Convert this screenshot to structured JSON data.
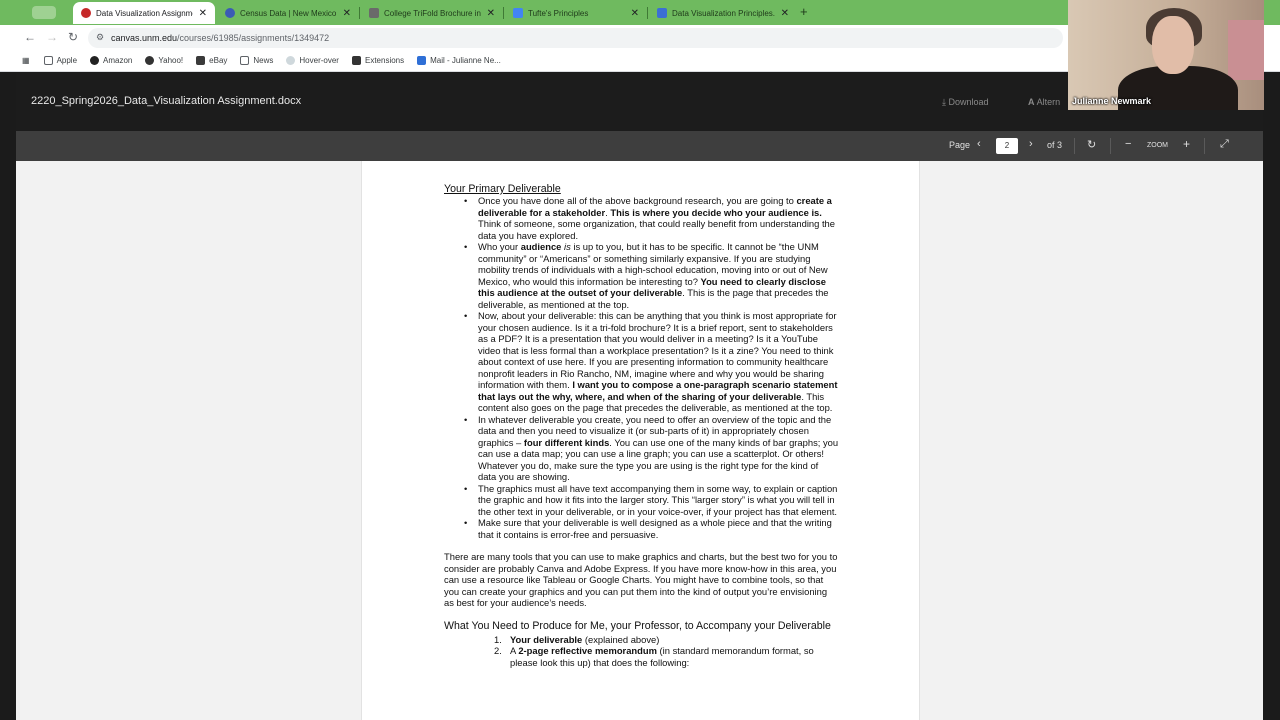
{
  "browser": {
    "tabs": [
      {
        "title": "Data Visualization Assignme...",
        "favicon_color": "#c62828",
        "active": true
      },
      {
        "title": "Census Data | New Mexico P...",
        "favicon_color": "#3b5bb5",
        "active": false
      },
      {
        "title": "College TriFold Brochure in P...",
        "favicon_color": "#6a6a6a",
        "active": false
      },
      {
        "title": "Tufte's Principles",
        "favicon_color": "#4285f4",
        "active": false
      },
      {
        "title": "Data Visualization Principles...",
        "favicon_color": "#3b6fd4",
        "active": false
      }
    ],
    "new_tab": "+",
    "url_host": "canvas.unm.edu",
    "url_path": "/courses/61985/assignments/1349472",
    "bookmarks": [
      {
        "label": "Apple",
        "icon": "folder-icon"
      },
      {
        "label": "Amazon",
        "icon": "amazon-icon"
      },
      {
        "label": "Yahoo!",
        "icon": "yahoo-icon"
      },
      {
        "label": "eBay",
        "icon": "ebay-icon"
      },
      {
        "label": "News",
        "icon": "folder-icon"
      },
      {
        "label": "Hover-over",
        "icon": "cloud-icon"
      },
      {
        "label": "Extensions",
        "icon": "puzzle-icon"
      },
      {
        "label": "Mail - Julianne Ne...",
        "icon": "mail-icon"
      }
    ]
  },
  "viewer": {
    "doc_title": "2220_Spring2026_Data_Visualization Assignment.docx",
    "download_label": "Download",
    "alt_label": "Altern",
    "page_label": "Page",
    "current_page": "2",
    "of_pages": "of 3",
    "zoom_label": "ZOOM"
  },
  "webcam": {
    "name": "Julianne Newmark"
  },
  "document": {
    "heading1": "Your Primary Deliverable",
    "b1": {
      "t1": "Once you have done all of the above background research, you are going to ",
      "b1": "create a deliverable for a stakeholder",
      "t2": ".  ",
      "b2": "This is where you decide who your audience is.",
      "t3": " Think of someone, some organization, that could really benefit from understanding the data you have explored."
    },
    "b2": {
      "t1": "Who your ",
      "b1": "audience",
      "i1": " is",
      "t2": " is up to you, but it has to be specific.  It cannot be “the UNM community” or “Americans” or something similarly expansive. If you are studying mobility trends of individuals with a high-school education, moving into or out of New Mexico, who would this information be interesting to?  ",
      "b2": "You need to clearly disclose this audience at the outset of your deliverable",
      "t3": ". This is the page that precedes the deliverable, as mentioned at the top."
    },
    "b3": {
      "t1": "Now, about your deliverable: this can be anything that you think is most appropriate for your chosen audience. Is it a tri-fold brochure?  It is a brief report, sent to stakeholders as a PDF?  It is a presentation that you would deliver in a meeting?  Is it a YouTube video that is less formal than a workplace presentation? Is it a zine? You need to think about context of use here.  If you are presenting information to community healthcare nonprofit leaders in Rio Rancho, NM, imagine where and why you would be sharing information with them. ",
      "b1": "I want you to compose a one-paragraph scenario statement that lays out the why, where, and when of the sharing of your deliverable",
      "t2": ". This content also goes on the page that precedes the deliverable, as mentioned at the top."
    },
    "b4": {
      "t1": "In whatever deliverable you create, you need to offer an overview of the topic and the data and then you need to visualize it (or sub-parts of it) in appropriately chosen graphics – ",
      "b1": "four different kinds",
      "t2": ". You can use one of the many kinds of bar graphs; you can use a data map; you can use a line graph; you can use a scatterplot.  Or others! Whatever you do, make sure the type you are using is the right type for the kind of data you are showing."
    },
    "b5": "The graphics must all have text accompanying them in some way, to explain or caption the graphic and how it fits into the larger story. This “larger story” is what you will tell in the other text in your deliverable, or in your voice-over, if your project has that element.",
    "b6": "Make sure that your deliverable is well designed as a whole piece and that the writing that it contains is error-free and persuasive.",
    "para": "There are many tools that you can use to make graphics and charts, but the best two for you to consider are probably Canva and Adobe Express.  If you have more know-how in this area, you can use a resource like Tableau or Google Charts. You might have to combine tools, so that you can create your graphics and you can put them into the kind of output you’re envisioning as best for your audience’s needs.",
    "heading2": "What You Need to Produce for Me, your Professor, to Accompany your Deliverable",
    "ol1": {
      "num": "1.",
      "b1": "Your deliverable",
      "t1": " (explained above)"
    },
    "ol2": {
      "num": "2.",
      "t0": "A ",
      "b1": "2-page reflective memorandum",
      "t1": " (in standard memorandum format, so please look this up) that does the following:"
    }
  }
}
